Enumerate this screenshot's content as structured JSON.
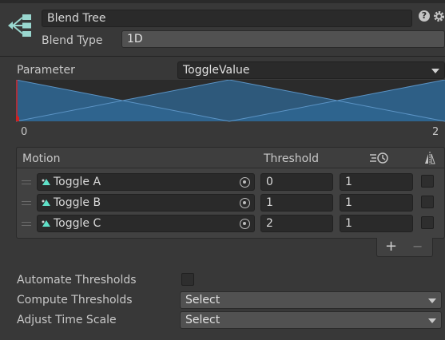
{
  "header": {
    "name_value": "Blend Tree",
    "blend_type_label": "Blend Type",
    "blend_type_value": "1D"
  },
  "parameter": {
    "label": "Parameter",
    "value": "ToggleValue"
  },
  "graph": {
    "min_label": "0",
    "max_label": "2"
  },
  "motion_list": {
    "motion_header": "Motion",
    "threshold_header": "Threshold",
    "rows": [
      {
        "motion": "Toggle A",
        "threshold": "0",
        "time_scale": "1"
      },
      {
        "motion": "Toggle B",
        "threshold": "1",
        "time_scale": "1"
      },
      {
        "motion": "Toggle C",
        "threshold": "2",
        "time_scale": "1"
      }
    ],
    "add_label": "+",
    "remove_label": "−"
  },
  "settings": {
    "automate_label": "Automate Thresholds",
    "compute_label": "Compute Thresholds",
    "compute_value": "Select",
    "adjust_label": "Adjust Time Scale",
    "adjust_value": "Select"
  },
  "colors": {
    "background": "#383838",
    "graph_fill": "#2f6590",
    "graph_line": "#5b93c4",
    "marker": "#d32020",
    "anim_icon": "#5fe0c8"
  },
  "icons": [
    "blend-tree-icon",
    "help-icon",
    "settings-icon",
    "dropdown-arrow-icon",
    "animation-clip-icon",
    "object-picker-icon",
    "time-scale-icon",
    "mirror-icon",
    "drag-handle-icon"
  ]
}
